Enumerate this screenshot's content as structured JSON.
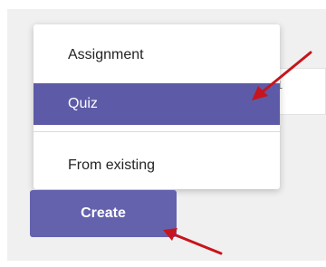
{
  "menu": {
    "items": [
      {
        "label": "Assignment",
        "selected": false
      },
      {
        "label": "Quiz",
        "selected": true
      },
      {
        "label": "From existing",
        "selected": false
      }
    ]
  },
  "create_button": {
    "label": "Create"
  },
  "background_glyph": "1",
  "colors": {
    "accent": "#6462ad",
    "selected_bg": "#5d5ba7",
    "annotation_arrow": "#c8141c",
    "panel_bg": "#f0f0f0"
  }
}
